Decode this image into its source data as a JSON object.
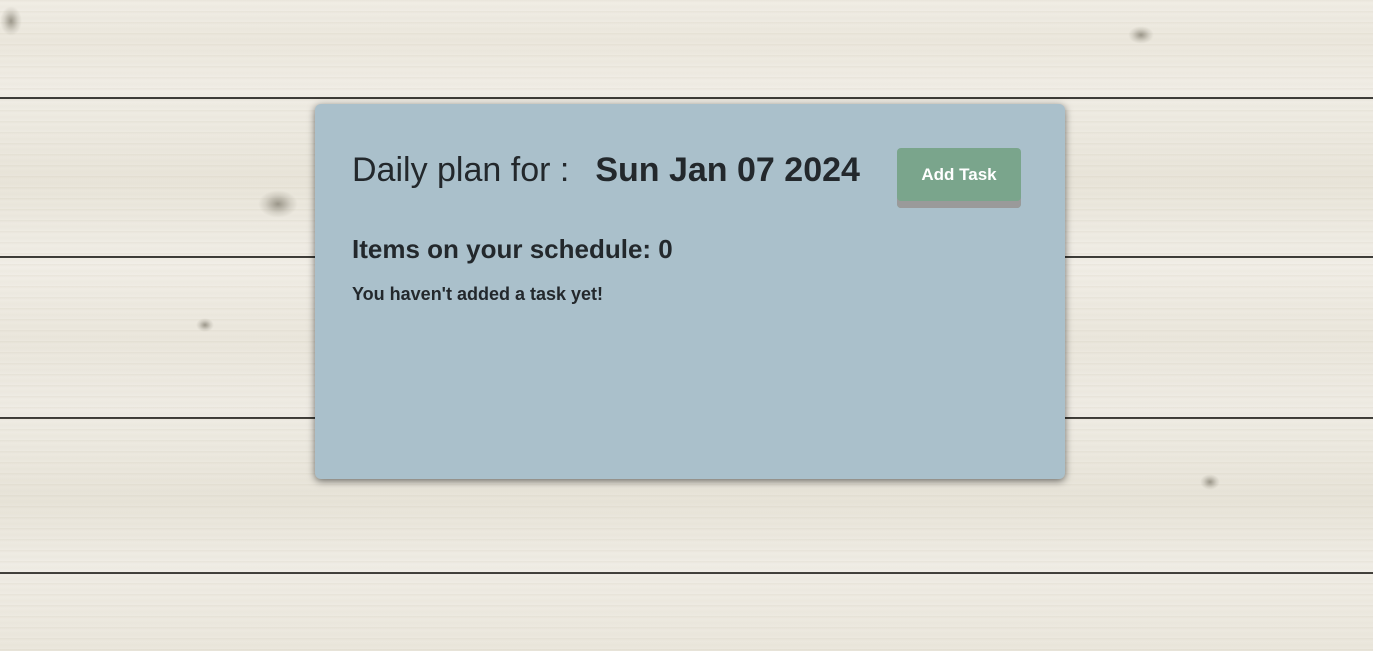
{
  "header": {
    "label": "Daily plan for :",
    "date": "Sun Jan 07 2024"
  },
  "actions": {
    "add_task_label": "Add Task"
  },
  "schedule": {
    "count_text": "Items on your schedule: 0",
    "empty_message": "You haven't added a task yet!"
  },
  "colors": {
    "card_background": "#aac0cb",
    "button_background": "#7aa58c",
    "text": "#23282c"
  }
}
